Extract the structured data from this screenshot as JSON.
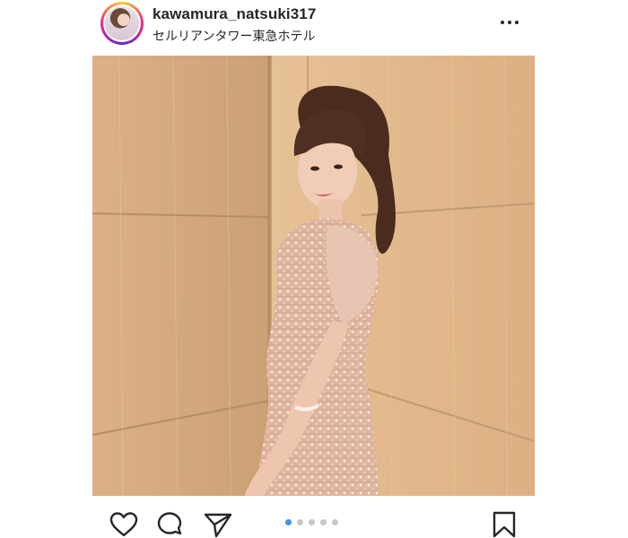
{
  "post": {
    "username": "kawamura_natsuki317",
    "location": "セルリアンタワー東急ホテル",
    "carousel": {
      "total": 5,
      "active_index": 0
    }
  },
  "icons": {
    "more": "more-options-icon",
    "like": "heart-icon",
    "comment": "comment-icon",
    "share": "share-icon",
    "save": "bookmark-icon"
  },
  "colors": {
    "text": "#262626",
    "dot_active": "#3897f0",
    "dot_inactive": "#c7c7c7"
  }
}
